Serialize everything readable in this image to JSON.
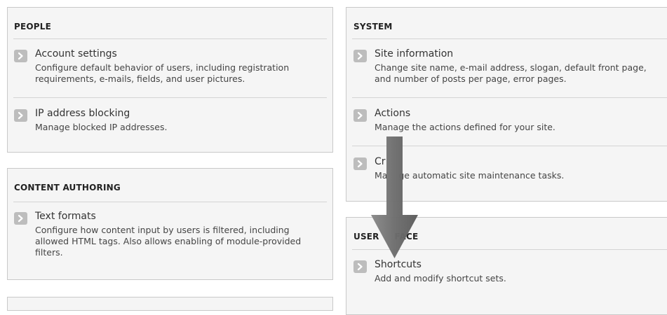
{
  "people": {
    "title": "PEOPLE",
    "items": [
      {
        "link": "Account settings",
        "desc": "Configure default behavior of users, including registration requirements, e-mails, fields, and user pictures.",
        "icon": "chevron-right-icon"
      },
      {
        "link": "IP address blocking",
        "desc": "Manage blocked IP addresses.",
        "icon": "chevron-right-icon"
      }
    ]
  },
  "content_authoring": {
    "title": "CONTENT AUTHORING",
    "items": [
      {
        "link": "Text formats",
        "desc": "Configure how content input by users is filtered, including allowed HTML tags. Also allows enabling of module-provided filters.",
        "icon": "chevron-right-icon"
      }
    ]
  },
  "system": {
    "title": "SYSTEM",
    "items": [
      {
        "link": "Site information",
        "desc": "Change site name, e-mail address, slogan, default front page, and number of posts per page, error pages.",
        "icon": "chevron-right-icon"
      },
      {
        "link": "Actions",
        "desc": "Manage the actions defined for your site.",
        "icon": "chevron-right-icon"
      },
      {
        "link": "Cr",
        "desc": "Ma    ge automatic site maintenance tasks.",
        "icon": "chevron-right-icon"
      }
    ]
  },
  "user_interface": {
    "title": "USER     FACE",
    "items": [
      {
        "link": "Shortcuts",
        "desc": "Add and modify shortcut sets.",
        "icon": "chevron-right-icon"
      }
    ]
  },
  "overlay": {
    "icon": "down-arrow-icon",
    "color": "#6e6e6e"
  },
  "colors": {
    "panel_bg": "#f5f5f5",
    "border": "#c9c9c9",
    "chevron_bg": "#bdbdbd"
  }
}
